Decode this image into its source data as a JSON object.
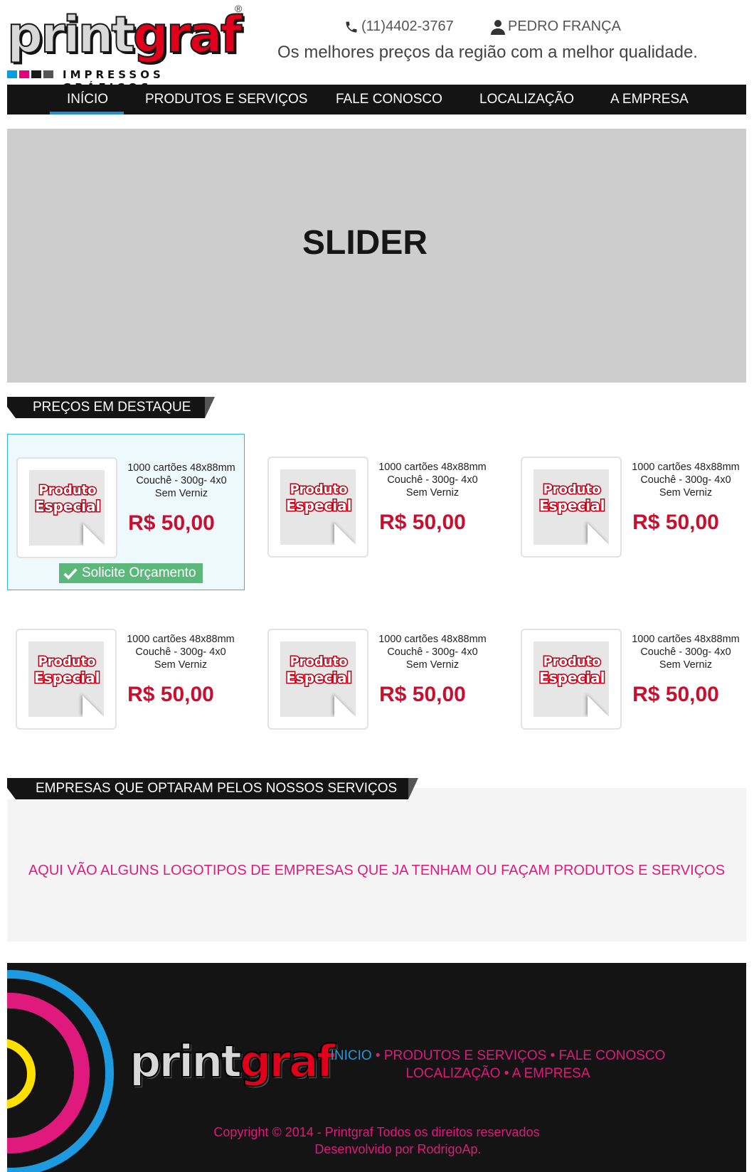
{
  "header": {
    "logo_part1": "print",
    "logo_part2": "graf",
    "logo_reg": "®",
    "logo_sub": "IMPRESSOS GRÁFICOS",
    "phone": "(11)4402-3767",
    "user": "PEDRO FRANÇA",
    "tagline": "Os melhores preços da região com a melhor qualidade."
  },
  "nav": {
    "items": [
      "INÍCIO",
      "PRODUTOS E SERVIÇOS",
      "FALE CONOSCO",
      "LOCALIZAÇÃO",
      "A EMPRESA"
    ],
    "active": "INÍCIO"
  },
  "slider": {
    "label": "SLIDER"
  },
  "featured": {
    "title": "PREÇOS EM DESTAQUE",
    "badge_line1": "Produto",
    "badge_line2": "Especial",
    "button_label": "Solicite Orçamento",
    "products": [
      {
        "desc1": "1000 cartões 48x88mm",
        "desc2": "Couchê - 300g- 4x0",
        "desc3": "Sem Verniz",
        "price": "R$ 50,00"
      },
      {
        "desc1": "1000 cartões 48x88mm",
        "desc2": "Couchê - 300g- 4x0",
        "desc3": "Sem Verniz",
        "price": "R$ 50,00"
      },
      {
        "desc1": "1000 cartões 48x88mm",
        "desc2": "Couchê - 300g- 4x0",
        "desc3": "Sem Verniz",
        "price": "R$ 50,00"
      },
      {
        "desc1": "1000 cartões 48x88mm",
        "desc2": "Couchê - 300g- 4x0",
        "desc3": "Sem Verniz",
        "price": "R$ 50,00"
      },
      {
        "desc1": "1000 cartões 48x88mm",
        "desc2": "Couchê - 300g- 4x0",
        "desc3": "Sem Verniz",
        "price": "R$ 50,00"
      },
      {
        "desc1": "1000 cartões 48x88mm",
        "desc2": "Couchê - 300g- 4x0",
        "desc3": "Sem Verniz",
        "price": "R$ 50,00"
      }
    ]
  },
  "companies": {
    "title": "EMPRESAS QUE OPTARAM PELOS NOSSOS SERVIÇOS",
    "text": "AQUI VÃO ALGUNS LOGOTIPOS DE EMPRESAS QUE JA TENHAM OU FAÇAM PRODUTOS E SERVIÇOS"
  },
  "footer": {
    "links": [
      "INICIO",
      "PRODUTOS E SERVIÇOS",
      "FALE CONOSCO",
      "LOCALIZAÇÃO",
      "A EMPRESA"
    ],
    "separator": "•",
    "copyright": "Copyright © 2014 - Printgraf Todos os direitos reservados",
    "developer": "Desenvolvido por RodrigoAp."
  },
  "colors": {
    "accent_blue": "#1e9be0",
    "brand_red": "#c8102e",
    "magenta": "#e0197d",
    "button_green": "#5cb87a",
    "dark": "#141414"
  },
  "icons": {
    "phone": "phone-icon",
    "user": "user-icon",
    "check": "check-icon"
  }
}
